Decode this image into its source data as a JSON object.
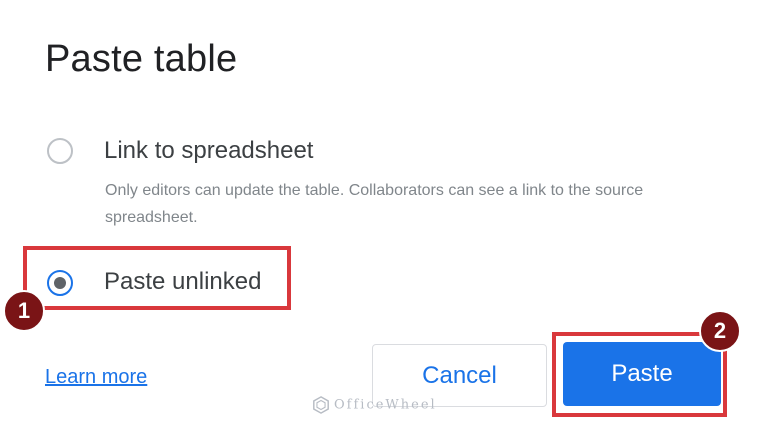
{
  "dialog": {
    "title": "Paste table",
    "options": [
      {
        "label": "Link to spreadsheet",
        "description": "Only editors can update the table. Collaborators can see a link to the source spreadsheet.",
        "selected": false
      },
      {
        "label": "Paste unlinked",
        "selected": true
      }
    ],
    "learn_more": "Learn more",
    "cancel_label": "Cancel",
    "paste_label": "Paste"
  },
  "annotations": {
    "step1": "1",
    "step2": "2",
    "highlight_color": "#d9383c",
    "marker_color": "#7a1416"
  },
  "watermark": {
    "text": "OfficeWheel",
    "icon": "officewheel-logo-icon"
  },
  "colors": {
    "accent": "#1a73e8",
    "text": "#202124"
  }
}
